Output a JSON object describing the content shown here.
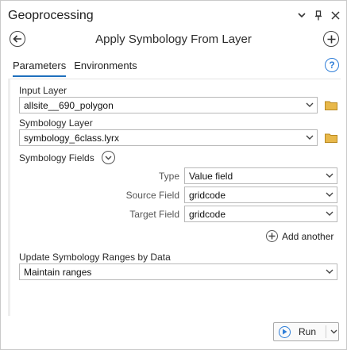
{
  "pane": {
    "title": "Geoprocessing",
    "controls": [
      "menu-chevron-icon",
      "pin-icon",
      "close-icon"
    ]
  },
  "tool": {
    "title": "Apply Symbology From Layer"
  },
  "tabs": [
    {
      "label": "Parameters",
      "active": true
    },
    {
      "label": "Environments",
      "active": false
    }
  ],
  "parameters": {
    "input_layer": {
      "label": "Input Layer",
      "value": "allsite__690_polygon"
    },
    "symbology_layer": {
      "label": "Symbology Layer",
      "value": "symbology_6class.lyrx"
    },
    "symbology_fields": {
      "label": "Symbology Fields",
      "type": {
        "label": "Type",
        "value": "Value field"
      },
      "source_field": {
        "label": "Source Field",
        "value": "gridcode"
      },
      "target_field": {
        "label": "Target Field",
        "value": "gridcode"
      },
      "add_another_label": "Add another"
    },
    "update_ranges": {
      "label": "Update Symbology Ranges by Data",
      "value": "Maintain ranges"
    }
  },
  "run": {
    "label": "Run"
  },
  "colors": {
    "accent": "#1e6fbd",
    "folder": "#e8b84a",
    "help": "#2f7ed8"
  }
}
